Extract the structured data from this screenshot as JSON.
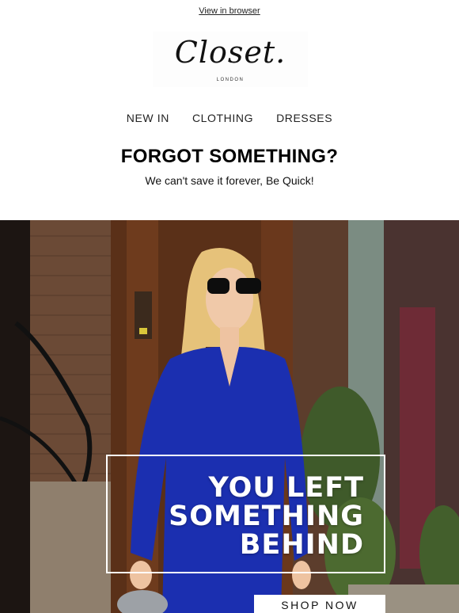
{
  "header": {
    "view_in_browser": "View in browser",
    "logo_text": "Closet.",
    "logo_sub": "LONDON"
  },
  "nav": {
    "items": [
      {
        "label": "NEW IN"
      },
      {
        "label": "CLOTHING"
      },
      {
        "label": "DRESSES"
      }
    ]
  },
  "main": {
    "headline": "FORGOT SOMETHING?",
    "subline": "We can't save it forever, Be Quick!"
  },
  "hero": {
    "line1": "YOU LEFT",
    "line2": "SOMETHING",
    "line3": "BEHIND",
    "cta": "SHOP NOW"
  },
  "colors": {
    "jumpsuit_blue": "#1b2fb0",
    "frame": "#ffffff"
  }
}
